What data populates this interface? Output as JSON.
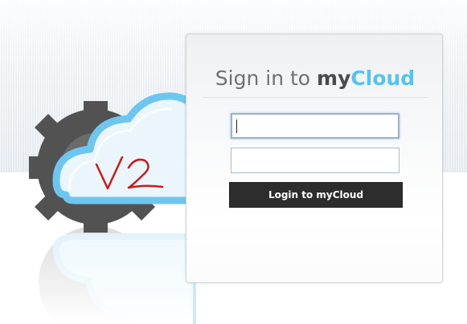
{
  "panel": {
    "title_prefix": "Sign in to ",
    "brand_my": "my",
    "brand_cloud": "Cloud"
  },
  "form": {
    "username_value": "",
    "password_value": "",
    "login_label": "Login to myCloud"
  },
  "logo": {
    "handwritten": "V2"
  },
  "colors": {
    "brand_blue": "#56c2ee",
    "brand_dark": "#4a4a4a",
    "gear": "#505050",
    "button": "#2d2d2d"
  }
}
